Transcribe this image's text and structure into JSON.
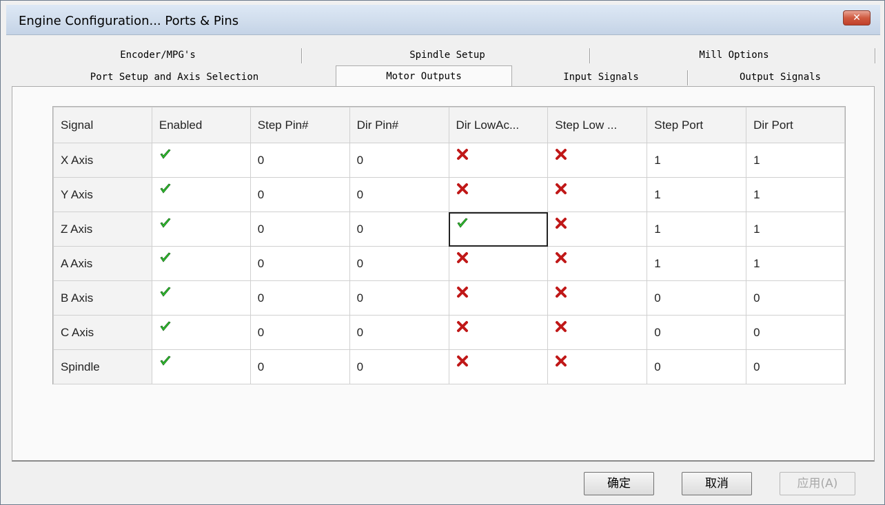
{
  "window": {
    "title": "Engine Configuration... Ports & Pins",
    "close_glyph": "✕"
  },
  "tabs": {
    "row1": [
      "Encoder/MPG's",
      "Spindle Setup",
      "Mill Options"
    ],
    "row2": [
      "Port Setup and Axis Selection",
      "Motor Outputs",
      "Input Signals",
      "Output Signals"
    ],
    "active": "Motor Outputs"
  },
  "grid": {
    "headers": [
      "Signal",
      "Enabled",
      "Step Pin#",
      "Dir Pin#",
      "Dir LowAc...",
      "Step Low ...",
      "Step Port",
      "Dir Port"
    ],
    "rows": [
      {
        "signal": "X Axis",
        "enabled": true,
        "step_pin": "0",
        "dir_pin": "0",
        "dir_low": false,
        "step_low": false,
        "step_port": "1",
        "dir_port": "1"
      },
      {
        "signal": "Y Axis",
        "enabled": true,
        "step_pin": "0",
        "dir_pin": "0",
        "dir_low": false,
        "step_low": false,
        "step_port": "1",
        "dir_port": "1"
      },
      {
        "signal": "Z Axis",
        "enabled": true,
        "step_pin": "0",
        "dir_pin": "0",
        "dir_low": true,
        "step_low": false,
        "step_port": "1",
        "dir_port": "1"
      },
      {
        "signal": "A Axis",
        "enabled": true,
        "step_pin": "0",
        "dir_pin": "0",
        "dir_low": false,
        "step_low": false,
        "step_port": "1",
        "dir_port": "1"
      },
      {
        "signal": "B Axis",
        "enabled": true,
        "step_pin": "0",
        "dir_pin": "0",
        "dir_low": false,
        "step_low": false,
        "step_port": "0",
        "dir_port": "0"
      },
      {
        "signal": "C Axis",
        "enabled": true,
        "step_pin": "0",
        "dir_pin": "0",
        "dir_low": false,
        "step_low": false,
        "step_port": "0",
        "dir_port": "0"
      },
      {
        "signal": "Spindle",
        "enabled": true,
        "step_pin": "0",
        "dir_pin": "0",
        "dir_low": false,
        "step_low": false,
        "step_port": "0",
        "dir_port": "0"
      }
    ],
    "selected_cell": "Z Axis / Dir LowAc...",
    "check_icon": "green-check-icon",
    "cross_icon": "red-cross-icon",
    "colors": {
      "check": "#2fbf2f",
      "cross": "#c01818"
    }
  },
  "buttons": {
    "ok": "确定",
    "cancel": "取消",
    "apply": "应用(A)"
  }
}
